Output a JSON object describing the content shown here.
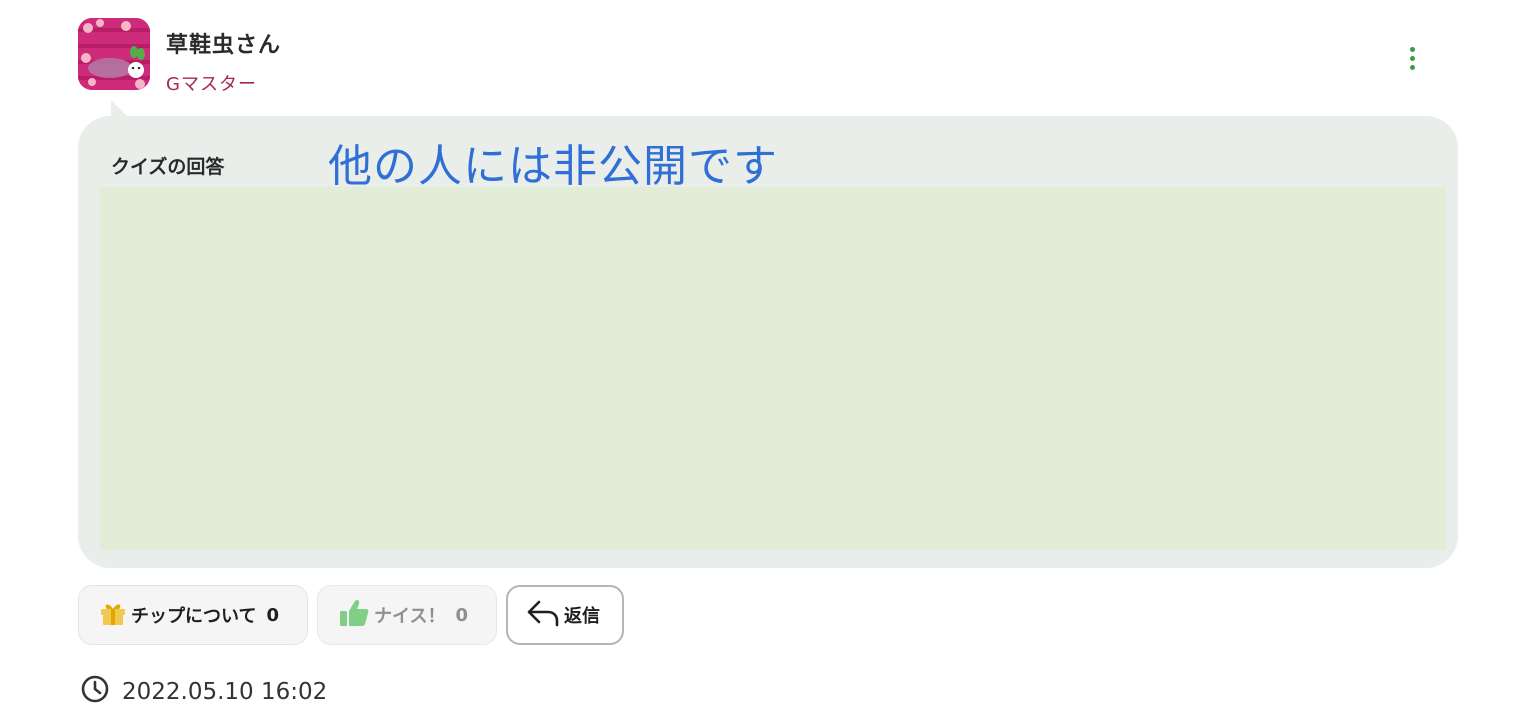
{
  "header": {
    "username": "草鞋虫さん",
    "rank": "Gマスター"
  },
  "answer": {
    "label": "クイズの回答",
    "private_note": "他の人には非公開です"
  },
  "actions": {
    "tip_label": "チップについて",
    "tip_count": "0",
    "nice_label": "ナイス！",
    "nice_count": "0",
    "reply_label": "返信"
  },
  "meta": {
    "timestamp": "2022.05.10 16:02"
  },
  "colors": {
    "accent_green": "#3d9a4a",
    "rank_color": "#a3275e",
    "private_note_color": "#2f6fd6",
    "answer_panel": "#e1edd6"
  },
  "icons": {
    "more": "more-vertical-icon",
    "tip": "gift-icon",
    "nice": "thumbs-up-icon",
    "reply": "reply-arrow-icon",
    "time": "clock-icon"
  }
}
